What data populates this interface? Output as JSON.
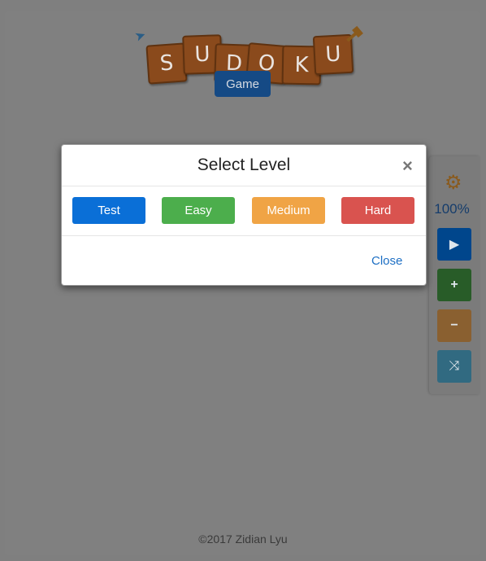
{
  "logo": {
    "letters": [
      "S",
      "U",
      "D",
      "O",
      "K",
      "U"
    ],
    "plane_icon": "paper-plane-icon",
    "hammer_icon": "hammer-icon"
  },
  "header": {
    "game_label": "Game"
  },
  "side_panel": {
    "settings_icon": "gear-icon",
    "zoom_level": "100%",
    "buttons": [
      {
        "icon": "play-icon",
        "glyph": "▶",
        "color": "#00468c"
      },
      {
        "icon": "plus-icon",
        "glyph": "+",
        "color": "#285c28"
      },
      {
        "icon": "minus-icon",
        "glyph": "−",
        "color": "#8a6030"
      },
      {
        "icon": "shuffle-icon",
        "glyph": "⤨",
        "color": "#316a81"
      }
    ]
  },
  "modal": {
    "title": "Select Level",
    "close_icon": "×",
    "levels": [
      {
        "label": "Test",
        "color": "#0a6fd7"
      },
      {
        "label": "Easy",
        "color": "#4cae4c"
      },
      {
        "label": "Medium",
        "color": "#f0a445"
      },
      {
        "label": "Hard",
        "color": "#d9534f"
      }
    ],
    "close_label": "Close"
  },
  "footer": {
    "text": "©2017 Zidian Lyu"
  }
}
